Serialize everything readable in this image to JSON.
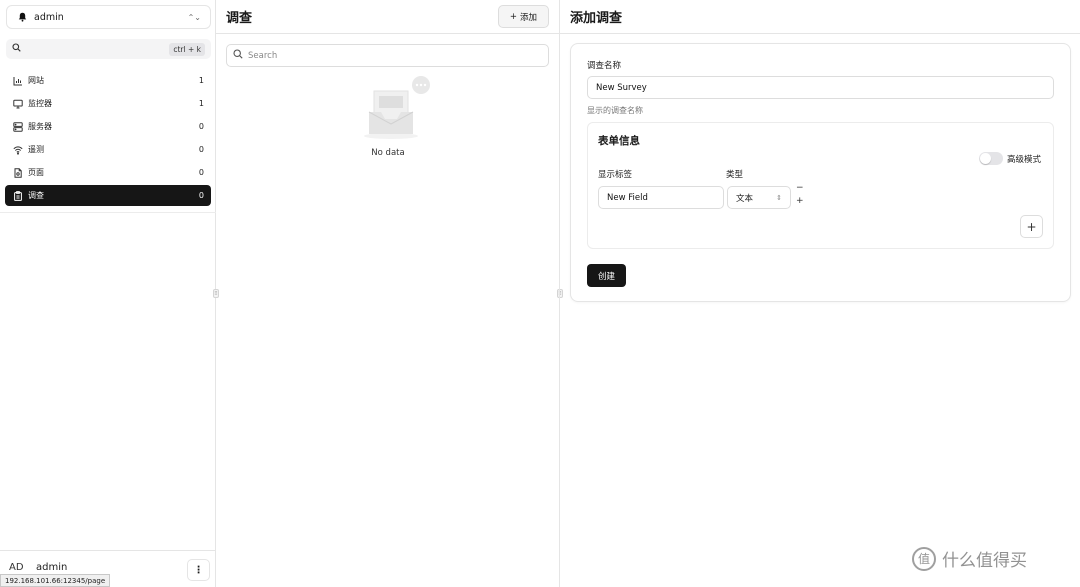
{
  "sidebar": {
    "workspace": "admin",
    "search_shortcut": "ctrl + k",
    "items": [
      {
        "icon": "chart-bar-icon",
        "label": "网站",
        "count": "1",
        "active": false
      },
      {
        "icon": "monitor-icon",
        "label": "监控器",
        "count": "1",
        "active": false
      },
      {
        "icon": "server-icon",
        "label": "服务器",
        "count": "0",
        "active": false
      },
      {
        "icon": "wifi-icon",
        "label": "遥测",
        "count": "0",
        "active": false
      },
      {
        "icon": "file-page-icon",
        "label": "页面",
        "count": "0",
        "active": false
      },
      {
        "icon": "clipboard-icon",
        "label": "调查",
        "count": "0",
        "active": true
      }
    ],
    "user": {
      "initials": "AD",
      "name": "admin"
    }
  },
  "status_url": "192.168.101.66:12345/page",
  "list_panel": {
    "title": "调查",
    "add_button": "添加",
    "search_placeholder": "Search",
    "empty_text": "No data"
  },
  "form_panel": {
    "title": "添加调查",
    "name_label": "调查名称",
    "name_value": "New Survey",
    "name_hint": "显示的调查名称",
    "form_section": {
      "title": "表单信息",
      "advanced_toggle": "高级模式",
      "advanced_on": false,
      "col_label": "显示标签",
      "col_type": "类型",
      "field_value": "New Field",
      "type_value": "文本"
    },
    "create_button": "创建"
  },
  "watermark": "什么值得买",
  "watermark_glyph": "值"
}
